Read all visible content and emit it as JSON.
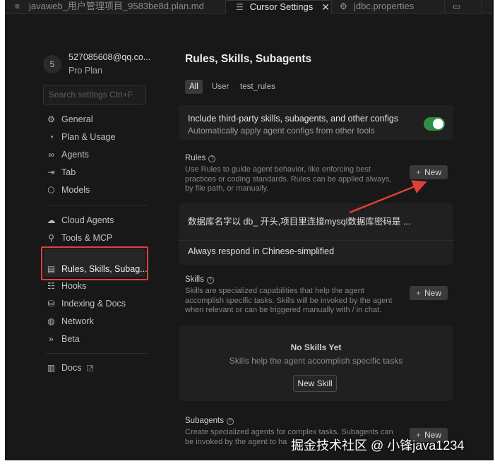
{
  "tabs": [
    {
      "label": "javaweb_用户管理项目_9583be8d.plan.md",
      "icon": "file-icon",
      "active": false
    },
    {
      "label": "Cursor Settings",
      "icon": "settings-icon",
      "active": true,
      "close": "✕"
    },
    {
      "label": "jdbc.properties",
      "icon": "gear-icon",
      "active": false
    }
  ],
  "account": {
    "avatar_letter": "5",
    "email": "527085608@qq.co...",
    "plan": "Pro Plan"
  },
  "search": {
    "placeholder": "Search settings Ctrl+F"
  },
  "nav": {
    "general": "General",
    "plan_usage": "Plan & Usage",
    "agents": "Agents",
    "tab": "Tab",
    "models": "Models",
    "cloud_agents": "Cloud Agents",
    "tools_mcp": "Tools & MCP",
    "rules": "Rules, Skills, Subag...",
    "hooks": "Hooks",
    "indexing": "Indexing & Docs",
    "network": "Network",
    "beta": "Beta",
    "docs": "Docs"
  },
  "page": {
    "title": "Rules, Skills, Subagents",
    "filters": [
      "All",
      "User",
      "test_rules"
    ],
    "third_party": {
      "title": "Include third-party skills, subagents, and other configs",
      "desc": "Automatically apply agent configs from other tools",
      "enabled": true
    },
    "rules": {
      "label": "Rules",
      "desc": "Use Rules to guide agent behavior, like enforcing best practices or coding standards. Rules can be applied always, by file path, or manually.",
      "new_label": "New",
      "items": [
        "数据库名字以 db_ 开头,项目里连接mysql数据库密码是 ...",
        "Always respond in Chinese-simplified"
      ]
    },
    "skills": {
      "label": "Skills",
      "desc": "Skills are specialized capabilities that help the agent accomplish specific tasks. Skills will be invoked by the agent when relevant or can be triggered manually with / in chat.",
      "new_label": "New",
      "empty_title": "No Skills Yet",
      "empty_desc": "Skills help the agent accomplish specific tasks",
      "new_skill": "New Skill"
    },
    "subagents": {
      "label": "Subagents",
      "desc": "Create specialized agents for complex tasks. Subagents can be invoked by the agent to ha",
      "new_label": "New"
    }
  },
  "watermark": "掘金技术社区 @ 小锋java1234",
  "colors": {
    "toggle_on": "#2f8f46",
    "highlight": "#e0403a",
    "arrow": "#e0403a"
  }
}
